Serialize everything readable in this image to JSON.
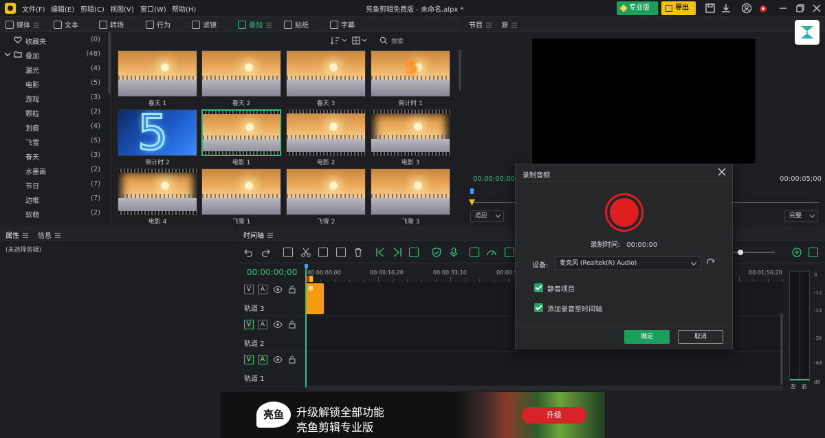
{
  "titlebar": {
    "menus": [
      "文件(F)",
      "编辑(E)",
      "剪辑(C)",
      "视图(V)",
      "窗口(W)",
      "帮助(H)"
    ],
    "title": "亮鱼剪辑免费版 - 未命名.alpx *",
    "pro_label": "专业版",
    "export_label": "导出"
  },
  "media_tabs": [
    "媒体",
    "文本",
    "转场",
    "行为",
    "滤镜",
    "叠加",
    "贴纸",
    "字幕"
  ],
  "categories": [
    {
      "label": "收藏夹",
      "count": "(0)"
    },
    {
      "label": "叠加",
      "count": "(48)"
    },
    {
      "label": "漏光",
      "count": "(4)"
    },
    {
      "label": "电影",
      "count": "(5)"
    },
    {
      "label": "游戏",
      "count": "(3)"
    },
    {
      "label": "颗粒",
      "count": "(2)"
    },
    {
      "label": "划痕",
      "count": "(4)"
    },
    {
      "label": "飞雪",
      "count": "(5)"
    },
    {
      "label": "春天",
      "count": "(3)"
    },
    {
      "label": "水墨画",
      "count": "(2)"
    },
    {
      "label": "节日",
      "count": "(7)"
    },
    {
      "label": "边框",
      "count": "(7)"
    },
    {
      "label": "软萌",
      "count": "(2)"
    }
  ],
  "search_placeholder": "搜索",
  "thumbnails": [
    "春天 1",
    "春天 2",
    "春天 3",
    "倒计时 1",
    "倒计时 2",
    "电影 1",
    "电影 2",
    "电影 3",
    "电影 4",
    "飞雪 1",
    "飞雪 2",
    "飞雪 3"
  ],
  "countdown_digit": "5",
  "preview": {
    "tabs": [
      "节目",
      "源"
    ],
    "time_current": "00:00:00;00",
    "time_total": "00:00:05;00",
    "fit_option": "适应",
    "quality_option": "完整"
  },
  "props": {
    "tabs": [
      "属性",
      "信息"
    ],
    "empty_text": "(未选择剪辑)"
  },
  "timeline": {
    "tab": "时间轴",
    "timecode": "00:00:00;00",
    "ruler": [
      "00:00:00;00",
      "00:00:16;20",
      "00:00:33;10",
      "00:00:50",
      "00:01:56;20"
    ],
    "tracks": [
      "轨道 3",
      "轨道 2",
      "轨道 1"
    ],
    "clip_label": "春",
    "meter_scale": [
      "0",
      "-12",
      "-24",
      "-36",
      "-48",
      "dB"
    ],
    "meter_channels": [
      "左",
      "右"
    ]
  },
  "dialog": {
    "title": "录制音频",
    "record_time_label": "录制时间:",
    "record_time": "00:00:00",
    "device_label": "设备:",
    "device_value": "麦克风 (Realtek(R) Audio)",
    "mute_label": "静音项目",
    "add_label": "添加录音至时间轴",
    "ok_label": "确定",
    "cancel_label": "取消"
  },
  "banner": {
    "logo_text": "亮鱼",
    "line1": "升级解锁全部功能",
    "line2": "亮鱼剪辑专业版",
    "button": "升级"
  },
  "colors": {
    "accent": "#2ec27e",
    "export": "#f5c400",
    "record": "#e01e1e",
    "clip": "#f39c12"
  }
}
